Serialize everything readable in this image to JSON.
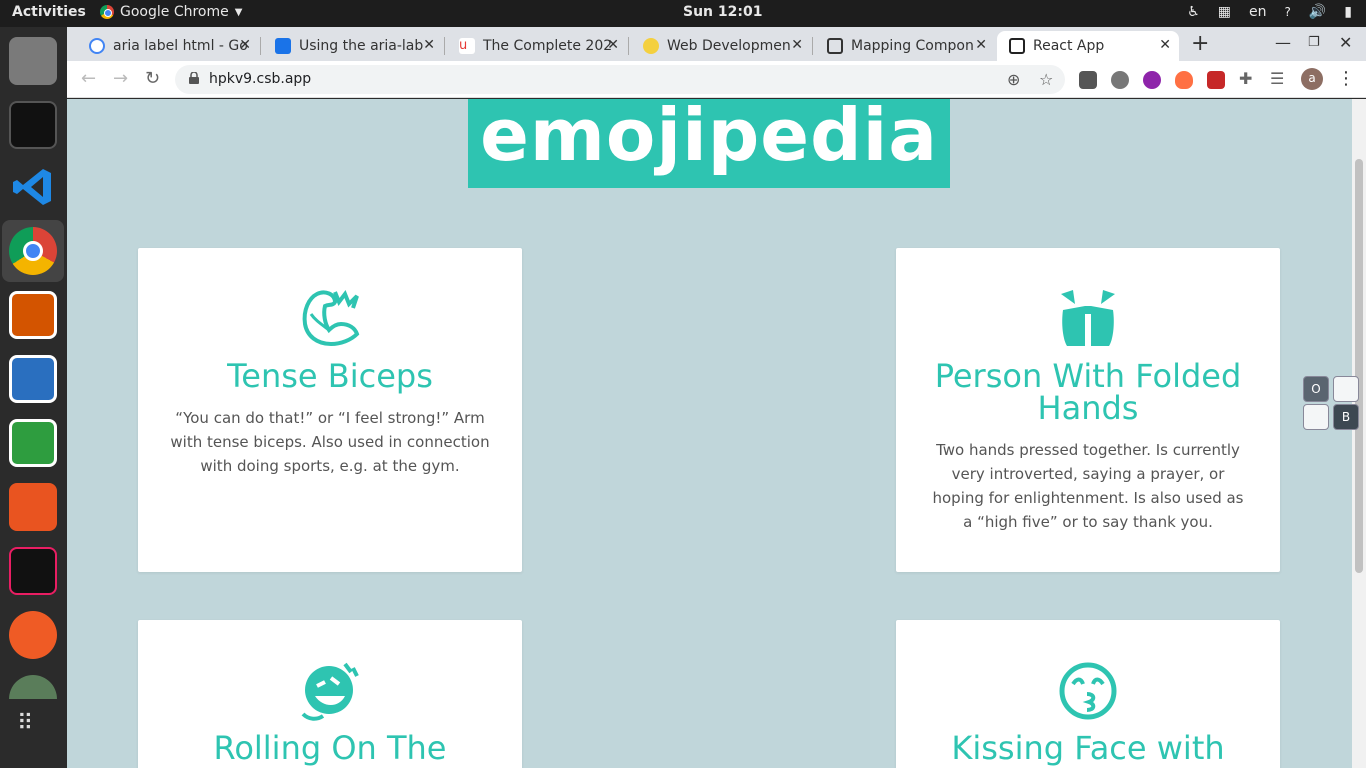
{
  "topbar": {
    "activities": "Activities",
    "app_name": "Google Chrome",
    "clock": "Sun 12:01",
    "language": "en"
  },
  "tabs": [
    {
      "title": "aria label html - Go",
      "icon_color": "#4285f4"
    },
    {
      "title": "Using the aria-lab",
      "icon_color": "#1a73e8"
    },
    {
      "title": "The Complete 202",
      "icon_color": "#e53935"
    },
    {
      "title": "Web Developmen",
      "icon_color": "#f4b400"
    },
    {
      "title": "Mapping Compon",
      "icon_color": "#333333"
    },
    {
      "title": "React App",
      "icon_color": "#222222"
    }
  ],
  "omnibox": {
    "url": "hpkv9.csb.app"
  },
  "page": {
    "banner": "emojipedia",
    "accent": "#2ec4b1",
    "background": "#c0d6da",
    "cards": [
      {
        "name": "Tense Biceps",
        "meaning": "“You can do that!” or “I feel strong!” Arm with tense biceps. Also used in connection with doing sports, e.g. at the gym.",
        "icon": "biceps-icon"
      },
      {
        "name": "Person With Folded Hands",
        "meaning": "Two hands pressed together. Is currently very introverted, saying a prayer, or hoping for enlightenment. Is also used as a “high five” or to say thank you.",
        "icon": "folded-hands-icon"
      },
      {
        "name": "Rolling On The",
        "meaning": "",
        "icon": "rolling-laughing-icon"
      },
      {
        "name": "Kissing Face with",
        "meaning": "",
        "icon": "kissing-face-icon"
      }
    ]
  },
  "sidewidget": {
    "o": "O",
    "b": "B"
  }
}
